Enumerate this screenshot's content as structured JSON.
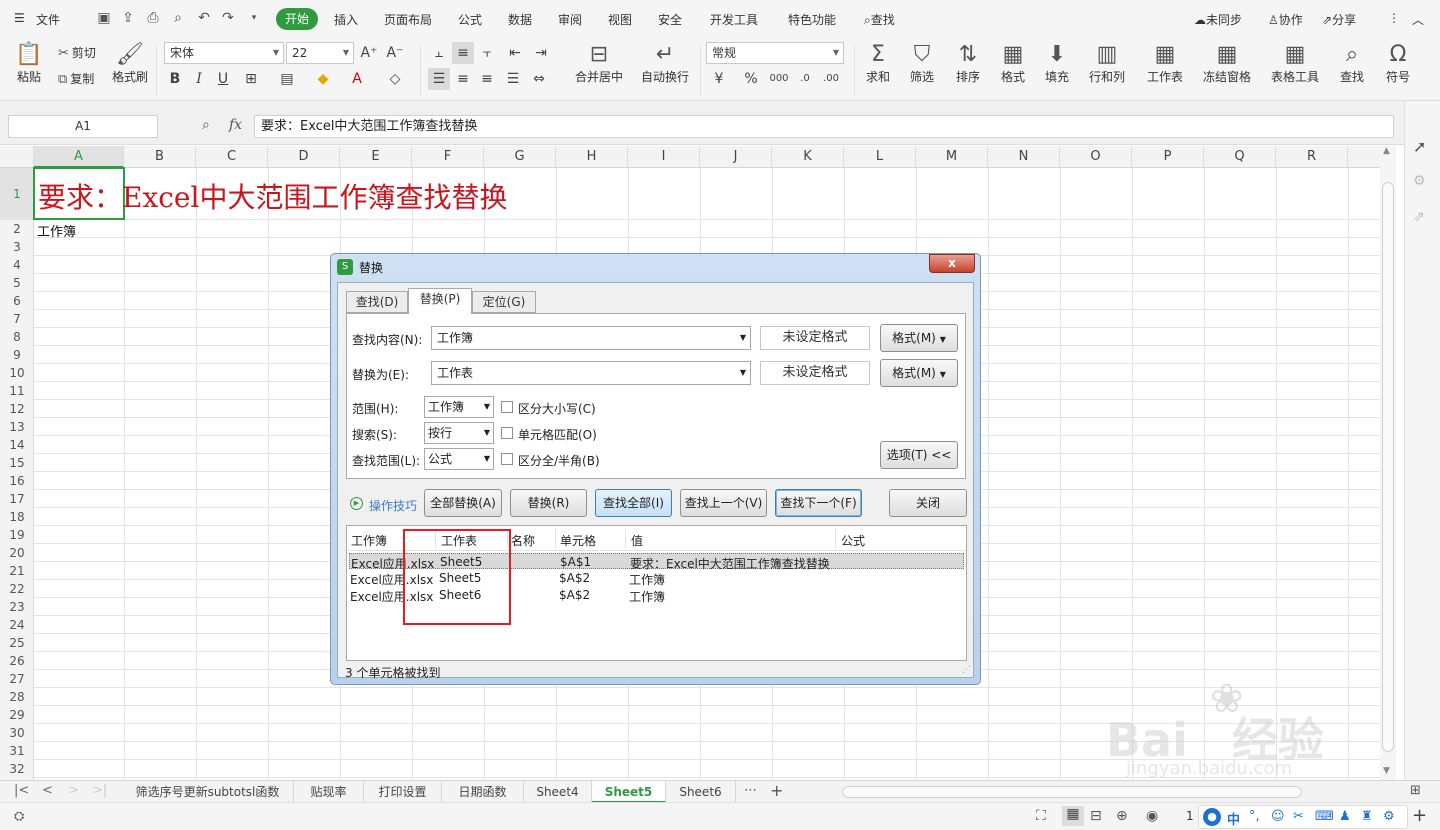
{
  "menubar": {
    "file": "文件",
    "tabs": [
      "开始",
      "插入",
      "页面布局",
      "公式",
      "数据",
      "审阅",
      "视图",
      "安全",
      "开发工具",
      "特色功能"
    ],
    "search": "查找",
    "sync": "未同步",
    "collab": "协作",
    "share": "分享"
  },
  "ribbon": {
    "paste": "粘贴",
    "cut": "剪切",
    "copy": "复制",
    "format_painter": "格式刷",
    "font_name": "宋体",
    "font_size": "22",
    "merge_center": "合并居中",
    "wrap_text": "自动换行",
    "number_format": "常规",
    "sum": "求和",
    "filter": "筛选",
    "sort": "排序",
    "format": "格式",
    "fill": "填充",
    "row_col": "行和列",
    "worksheet": "工作表",
    "freeze": "冻结窗格",
    "table_tools": "表格工具",
    "find": "查找",
    "symbol": "符号"
  },
  "formula_bar": {
    "name_box": "A1",
    "fx": "fx",
    "content": "要求：Excel中大范围工作簿查找替换"
  },
  "grid": {
    "columns": [
      "A",
      "B",
      "C",
      "D",
      "E",
      "F",
      "G",
      "H",
      "I",
      "J",
      "K",
      "L",
      "M",
      "N",
      "O",
      "P",
      "Q",
      "R"
    ],
    "rows": [
      "1",
      "2",
      "3",
      "4",
      "5",
      "6",
      "7",
      "8",
      "9",
      "10",
      "11",
      "12",
      "13",
      "14",
      "15",
      "16",
      "17",
      "18",
      "19",
      "20",
      "21",
      "22",
      "23",
      "24",
      "25",
      "26",
      "27",
      "28",
      "29",
      "30",
      "31",
      "32"
    ],
    "a1": "要求：Excel中大范围工作簿查找替换",
    "a2": "工作簿"
  },
  "sheet_tabs": [
    "筛选序号更新subtotsl函数",
    "贴现率",
    "打印设置",
    "日期函数",
    "Sheet4",
    "Sheet5",
    "Sheet6"
  ],
  "active_sheet": "Sheet5",
  "statusbar": {
    "zoom": "1"
  },
  "dialog": {
    "title": "替换",
    "tabs": [
      "查找(D)",
      "替换(P)",
      "定位(G)"
    ],
    "find_label": "查找内容(N):",
    "find_value": "工作簿",
    "replace_label": "替换为(E):",
    "replace_value": "工作表",
    "no_format": "未设定格式",
    "format_btn": "格式(M)",
    "scope_label": "范围(H):",
    "scope_value": "工作簿",
    "search_label": "搜索(S):",
    "search_value": "按行",
    "lookin_label": "查找范围(L):",
    "lookin_value": "公式",
    "match_case": "区分大小写(C)",
    "match_cell": "单元格匹配(O)",
    "match_width": "区分全/半角(B)",
    "options_btn": "选项(T) <<",
    "tips": "操作技巧",
    "replace_all": "全部替换(A)",
    "replace": "替换(R)",
    "find_all": "查找全部(I)",
    "find_prev": "查找上一个(V)",
    "find_next": "查找下一个(F)",
    "close": "关闭",
    "result_headers": [
      "工作簿",
      "工作表",
      "名称",
      "单元格",
      "值",
      "公式"
    ],
    "results": [
      {
        "book": "Excel应用.xlsx",
        "sheet": "Sheet5",
        "name": "",
        "cell": "$A$1",
        "value": "要求：Excel中大范围工作簿查找替换",
        "formula": ""
      },
      {
        "book": "Excel应用.xlsx",
        "sheet": "Sheet5",
        "name": "",
        "cell": "$A$2",
        "value": "工作簿",
        "formula": ""
      },
      {
        "book": "Excel应用.xlsx",
        "sheet": "Sheet6",
        "name": "",
        "cell": "$A$2",
        "value": "工作簿",
        "formula": ""
      }
    ],
    "status": "3 个单元格被找到"
  },
  "watermark": "Bai du 经验 jingyan.baidu.com",
  "colors": {
    "accent": "#2e9b3f",
    "highlight": "#e02020",
    "a1_text": "#c8161d"
  }
}
